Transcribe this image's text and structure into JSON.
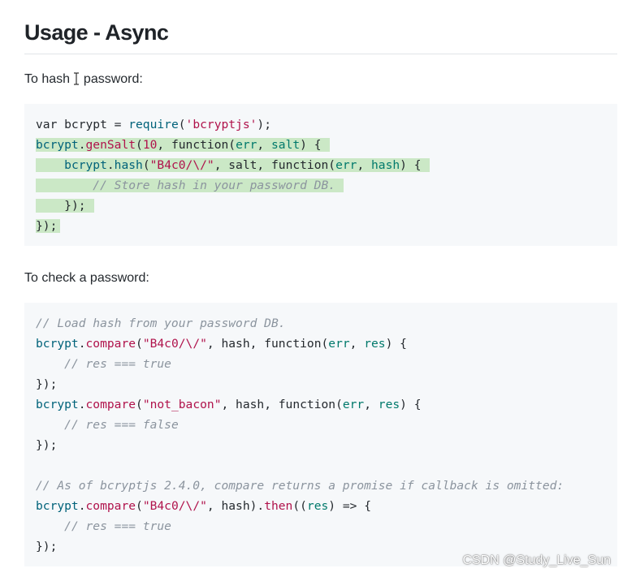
{
  "heading": "Usage - Async",
  "paragraphs": {
    "hash_prefix": "To hash ",
    "hash_suffix": " password:",
    "check": "To check a password:"
  },
  "hash_code": {
    "l1": {
      "a": "var bcrypt = ",
      "b": "require",
      "c": "(",
      "d": "'bcryptjs'",
      "e": ");"
    },
    "l2": {
      "a": "bcrypt",
      "b": ".",
      "c": "genSalt",
      "d": "(",
      "e": "10",
      "f": ", function(",
      "g": "err",
      "h": ", ",
      "i": "salt",
      "j": ") {"
    },
    "l3": {
      "indent": "    ",
      "a": "bcrypt",
      "b": ".",
      "c": "hash",
      "d": "(",
      "e": "\"B4c0/\\/\"",
      "f": ", salt, function(",
      "g": "err",
      "h": ", ",
      "i": "hash",
      "j": ") {"
    },
    "l4": {
      "indent": "        ",
      "a": "// Store hash in your password DB."
    },
    "l5": {
      "indent": "    ",
      "a": "});"
    },
    "l6": {
      "a": "});"
    }
  },
  "check_code": {
    "l1": "// Load hash from your password DB.",
    "l2": {
      "a": "bcrypt",
      "b": ".",
      "c": "compare",
      "d": "(",
      "e": "\"B4c0/\\/\"",
      "f": ", hash, function(",
      "g": "err",
      "h": ", ",
      "i": "res",
      "j": ") {"
    },
    "l3": {
      "indent": "    ",
      "a": "// res === true"
    },
    "l4": "});",
    "l5": {
      "a": "bcrypt",
      "b": ".",
      "c": "compare",
      "d": "(",
      "e": "\"not_bacon\"",
      "f": ", hash, function(",
      "g": "err",
      "h": ", ",
      "i": "res",
      "j": ") {"
    },
    "l6": {
      "indent": "    ",
      "a": "// res === false"
    },
    "l7": "});",
    "l8": "",
    "l9": "// As of bcryptjs 2.4.0, compare returns a promise if callback is omitted:",
    "l10": {
      "a": "bcrypt",
      "b": ".",
      "c": "compare",
      "d": "(",
      "e": "\"B4c0/\\/\"",
      "f": ", hash).",
      "g": "then",
      "h": "((",
      "i": "res",
      "j": ") => {"
    },
    "l11": {
      "indent": "    ",
      "a": "// res === true"
    },
    "l12": "});"
  },
  "watermark": "CSDN @Study_Live_Sun",
  "colors": {
    "selection": "#cbe8c6",
    "code_background": "#f6f8fa",
    "string": "#b0124b",
    "identifier": "#00627a",
    "param": "#00796b",
    "comment": "#8b949e"
  },
  "icons": {
    "cursor": "text-cursor-icon"
  }
}
